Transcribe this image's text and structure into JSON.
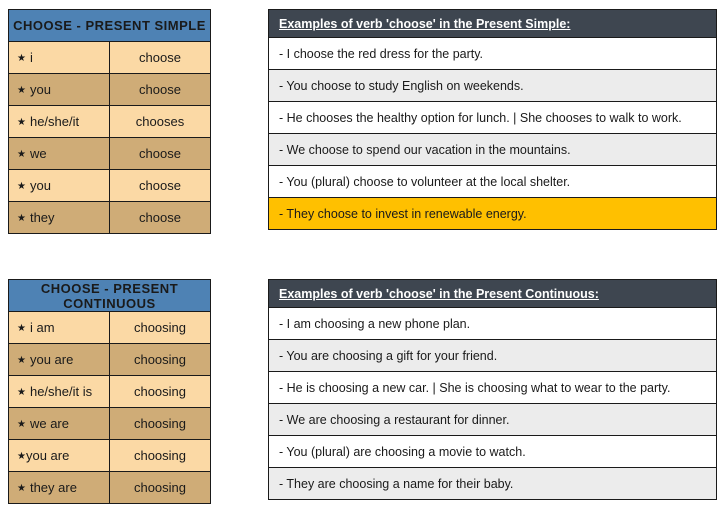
{
  "blocks": [
    {
      "id": "present-simple",
      "conjugation": {
        "title": "CHOOSE - PRESENT SIMPLE",
        "star": "★",
        "rows": [
          {
            "pronoun": "i",
            "form": "choose",
            "shade": "light",
            "tight": false
          },
          {
            "pronoun": "you",
            "form": "choose",
            "shade": "dark",
            "tight": false
          },
          {
            "pronoun": "he/she/it",
            "form": "chooses",
            "shade": "light",
            "tight": false
          },
          {
            "pronoun": "we",
            "form": "choose",
            "shade": "dark",
            "tight": false
          },
          {
            "pronoun": "you",
            "form": "choose",
            "shade": "light",
            "tight": false
          },
          {
            "pronoun": "they",
            "form": "choose",
            "shade": "dark",
            "tight": false
          }
        ]
      },
      "examples": {
        "title": "Examples of verb 'choose' in the Present Simple:",
        "rows": [
          {
            "text": "- I choose the red dress for the party.",
            "style": "plain"
          },
          {
            "text": "- You choose to study English on weekends.",
            "style": "alt"
          },
          {
            "text": "- He chooses the healthy option for lunch. | She chooses to walk to work.",
            "style": "plain"
          },
          {
            "text": "- We choose to spend our vacation in the mountains.",
            "style": "alt"
          },
          {
            "text": "- You (plural) choose to volunteer at the local shelter.",
            "style": "plain"
          },
          {
            "text": "- They choose to invest in renewable energy.",
            "style": "highlight"
          }
        ]
      }
    },
    {
      "id": "present-continuous",
      "conjugation": {
        "title": "CHOOSE - PRESENT CONTINUOUS",
        "star": "★",
        "rows": [
          {
            "pronoun": "i am",
            "form": "choosing",
            "shade": "light",
            "tight": false
          },
          {
            "pronoun": "you are",
            "form": "choosing",
            "shade": "dark",
            "tight": false
          },
          {
            "pronoun": "he/she/it is",
            "form": "choosing",
            "shade": "light",
            "tight": false
          },
          {
            "pronoun": "we are",
            "form": "choosing",
            "shade": "dark",
            "tight": false
          },
          {
            "pronoun": "you are",
            "form": "choosing",
            "shade": "light",
            "tight": true
          },
          {
            "pronoun": "they are",
            "form": "choosing",
            "shade": "dark",
            "tight": false
          }
        ]
      },
      "examples": {
        "title": "Examples of verb 'choose' in the Present Continuous:",
        "rows": [
          {
            "text": "- I am choosing a new phone plan.",
            "style": "plain"
          },
          {
            "text": "- You are choosing a gift for your friend.",
            "style": "alt"
          },
          {
            "text": "- He is choosing a new car. | She is choosing what to wear to the party.",
            "style": "plain"
          },
          {
            "text": "- We are choosing a restaurant for dinner.",
            "style": "alt"
          },
          {
            "text": "- You (plural) are choosing a movie to watch.",
            "style": "plain"
          },
          {
            "text": "- They are choosing a name for their baby.",
            "style": "alt"
          }
        ]
      }
    }
  ],
  "colors": {
    "header_blue": "#4e82b4",
    "header_slate": "#3e4650",
    "row_light_tan": "#fbd9a5",
    "row_dark_tan": "#cfac77",
    "row_alt_gray": "#ececec",
    "row_highlight_amber": "#ffc000",
    "border": "#1a1a1a"
  }
}
